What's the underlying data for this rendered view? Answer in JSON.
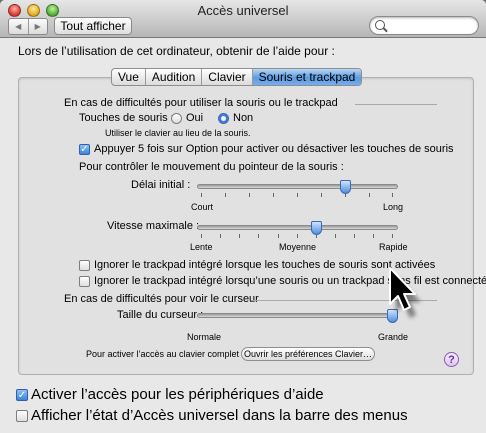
{
  "window": {
    "title": "Accès universel"
  },
  "toolbar": {
    "show_all_label": "Tout afficher",
    "search": {
      "placeholder": "",
      "value": ""
    }
  },
  "intro": "Lors de l’utilisation de cet ordinateur, obtenir de l’aide pour :",
  "tabs": [
    "Vue",
    "Audition",
    "Clavier",
    "Souris et trackpad"
  ],
  "active_tab": "Souris et trackpad",
  "mouse_section": {
    "title": "En cas de difficultés pour utiliser la souris ou le trackpad",
    "mouse_keys_label": "Touches de souris :",
    "option_yes": "Oui",
    "option_no": "Non",
    "mouse_keys_selected": "Non",
    "hint": "Utiliser le clavier au lieu de la souris.",
    "option_toggle_label": "Appuyer 5 fois sur Option pour activer ou désactiver les touches de souris",
    "option_toggle_checked": true,
    "pointer_control_label": "Pour contrôler le mouvement du pointeur de la souris :",
    "initial_delay": {
      "label": "Délai initial :",
      "min_label": "Court",
      "max_label": "Long",
      "value_fraction": 0.75
    },
    "max_speed": {
      "label": "Vitesse maximale :",
      "min_label": "Lente",
      "mid_label": "Moyenne",
      "max_label": "Rapide",
      "value_fraction": 0.6
    },
    "ignore_trackpad_1": {
      "label": "Ignorer le trackpad intégré lorsque les touches de souris sont activées",
      "checked": false
    },
    "ignore_trackpad_2": {
      "label": "Ignorer le trackpad intégré lorsqu’une souris ou un trackpad sans fil est connecté",
      "checked": false
    }
  },
  "cursor_section": {
    "title": "En cas de difficultés pour voir le curseur",
    "cursor_size": {
      "label": "Taille du curseur :",
      "min_label": "Normale",
      "max_label": "Grande",
      "value_fraction": 1.0
    },
    "keyboard_access_label": "Pour activer l’accès au clavier complet :",
    "open_keyboard_prefs_button": "Ouvrir les préférences Clavier…"
  },
  "bottom": {
    "assistive_devices": {
      "label": "Activer l’accès pour les périphériques d’aide",
      "checked": true
    },
    "show_in_menu_bar": {
      "label": "Afficher l’état d’Accès universel dans la barre des menus",
      "checked": false
    }
  },
  "colors": {
    "accent": "#3a84de",
    "panel": "#e1e1e1"
  }
}
